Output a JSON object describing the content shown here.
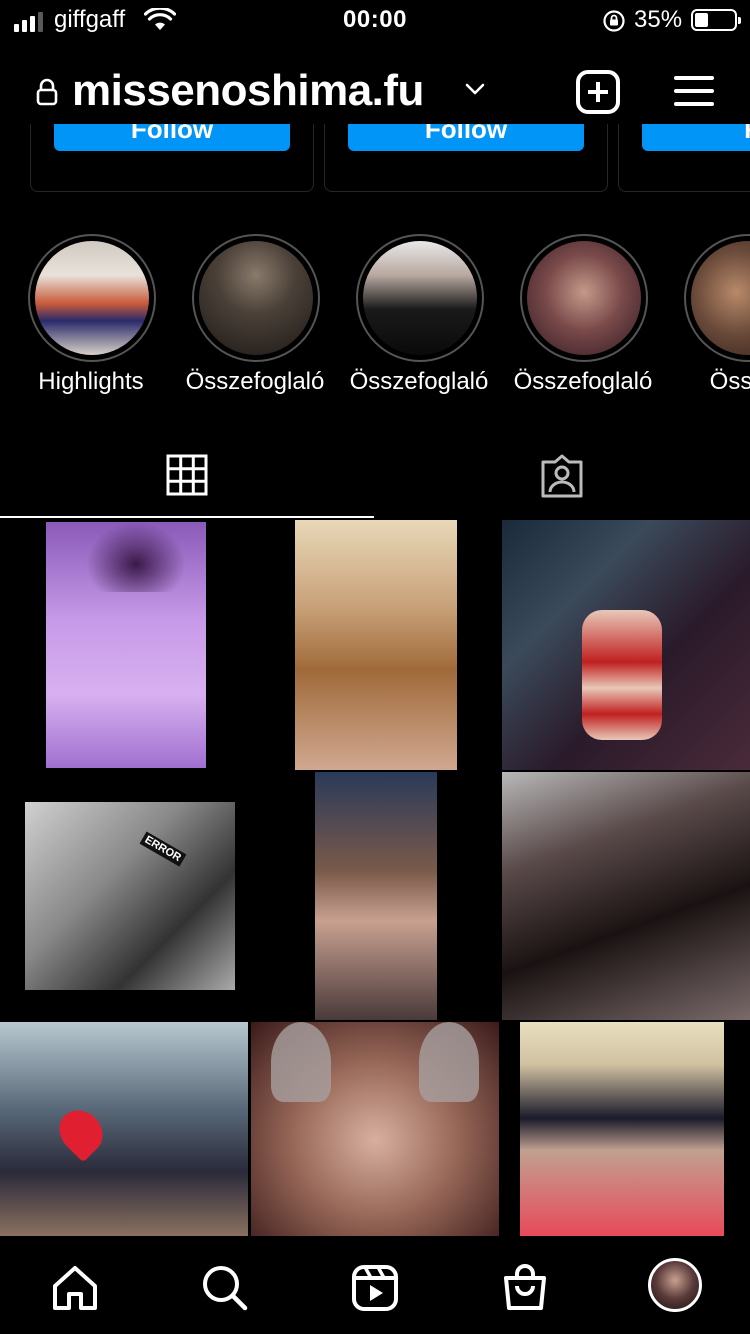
{
  "status_bar": {
    "carrier": "giffgaff",
    "time": "00:00",
    "battery_percent": "35%",
    "battery_level": 0.35
  },
  "header": {
    "username": "missenoshima.fu"
  },
  "suggested": {
    "cards": [
      {
        "button_label": "Follow"
      },
      {
        "button_label": "Follow"
      },
      {
        "button_label": "Fo"
      }
    ]
  },
  "highlights": [
    {
      "label": "Highlights"
    },
    {
      "label": "Összefoglaló"
    },
    {
      "label": "Összefoglaló"
    },
    {
      "label": "Összefoglaló"
    },
    {
      "label": "Összef"
    }
  ],
  "tabs": [
    {
      "name": "grid",
      "icon": "grid-icon",
      "active": true
    },
    {
      "name": "tagged",
      "icon": "tagged-person-icon",
      "active": false
    }
  ],
  "posts": [
    {
      "overlay_text": ""
    },
    {
      "overlay_text": ""
    },
    {
      "overlay_text": ""
    },
    {
      "overlay_text": "ERROR"
    },
    {
      "overlay_text": ""
    },
    {
      "overlay_text": ""
    },
    {
      "overlay_text": ""
    },
    {
      "overlay_text": ""
    },
    {
      "overlay_text": ""
    }
  ],
  "bottom_nav": [
    {
      "icon": "home-icon"
    },
    {
      "icon": "search-icon"
    },
    {
      "icon": "reels-icon"
    },
    {
      "icon": "shop-icon"
    },
    {
      "icon": "profile-avatar"
    }
  ],
  "colors": {
    "background": "#000000",
    "follow_button": "#0095f6",
    "text": "#ffffff"
  }
}
